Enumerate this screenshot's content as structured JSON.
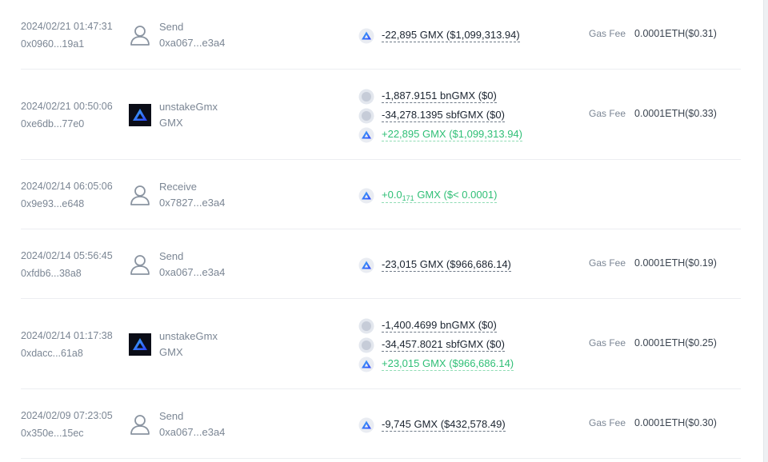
{
  "colors": {
    "text_dark": "#1b2430",
    "text_muted": "#7b8694",
    "positive": "#2fbf76",
    "divider": "#eceef1",
    "gmx_blue": "#2d42fc",
    "gmx_cyan": "#3fb6f5"
  },
  "gas_label": "Gas Fee",
  "transactions": [
    {
      "time": "2024/02/21 01:47:31",
      "hash": "0x0960...19a1",
      "action_icon": "user-icon",
      "action": "Send",
      "action_sub": "0xa067...e3a4",
      "tokens": [
        {
          "icon": "gmx-token-icon",
          "amount": "-22,895 GMX ($1,099,313.94)",
          "positive": false
        }
      ],
      "gas_fee": "0.0001ETH($0.31)"
    },
    {
      "time": "2024/02/21 00:50:06",
      "hash": "0xe6db...77e0",
      "action_icon": "gmx-logo-icon",
      "action": "unstakeGmx",
      "action_sub": "GMX",
      "tokens": [
        {
          "icon": "generic-token-icon",
          "amount": "-1,887.9151 bnGMX ($0)",
          "positive": false
        },
        {
          "icon": "generic-token-icon",
          "amount": "-34,278.1395 sbfGMX ($0)",
          "positive": false
        },
        {
          "icon": "gmx-token-icon",
          "amount": "+22,895 GMX ($1,099,313.94)",
          "positive": true
        }
      ],
      "gas_fee": "0.0001ETH($0.33)"
    },
    {
      "time": "2024/02/14 06:05:06",
      "hash": "0x9e93...e648",
      "action_icon": "user-icon",
      "action": "Receive",
      "action_sub": "0x7827...e3a4",
      "tokens": [
        {
          "icon": "gmx-token-icon",
          "amount_prefix": "+0.0",
          "amount_sub": "171",
          "amount_suffix": " GMX ($< 0.0001)",
          "positive": true
        }
      ],
      "gas_fee": ""
    },
    {
      "time": "2024/02/14 05:56:45",
      "hash": "0xfdb6...38a8",
      "action_icon": "user-icon",
      "action": "Send",
      "action_sub": "0xa067...e3a4",
      "tokens": [
        {
          "icon": "gmx-token-icon",
          "amount": "-23,015 GMX ($966,686.14)",
          "positive": false
        }
      ],
      "gas_fee": "0.0001ETH($0.19)"
    },
    {
      "time": "2024/02/14 01:17:38",
      "hash": "0xdacc...61a8",
      "action_icon": "gmx-logo-icon",
      "action": "unstakeGmx",
      "action_sub": "GMX",
      "tokens": [
        {
          "icon": "generic-token-icon",
          "amount": "-1,400.4699 bnGMX ($0)",
          "positive": false
        },
        {
          "icon": "generic-token-icon",
          "amount": "-34,457.8021 sbfGMX ($0)",
          "positive": false
        },
        {
          "icon": "gmx-token-icon",
          "amount": "+23,015 GMX ($966,686.14)",
          "positive": true
        }
      ],
      "gas_fee": "0.0001ETH($0.25)"
    },
    {
      "time": "2024/02/09 07:23:05",
      "hash": "0x350e...15ec",
      "action_icon": "user-icon",
      "action": "Send",
      "action_sub": "0xa067...e3a4",
      "tokens": [
        {
          "icon": "gmx-token-icon",
          "amount": "-9,745 GMX ($432,578.49)",
          "positive": false
        }
      ],
      "gas_fee": "0.0001ETH($0.30)"
    }
  ]
}
